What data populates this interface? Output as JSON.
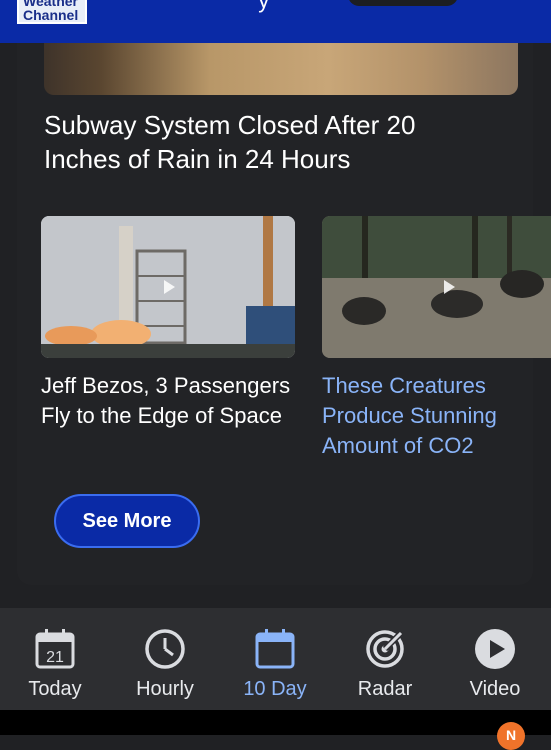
{
  "header": {
    "logo_line1": "Weather",
    "logo_line2": "Channel",
    "partial_text": "'y",
    "colors": {
      "bar": "#0a2aa6"
    }
  },
  "feature": {
    "title": "Subway System Closed After 20 Inches of Rain in 24 Hours"
  },
  "videos": [
    {
      "title": "Jeff Bezos, 3 Passengers Fly to the Edge of Space",
      "icon": "play-icon"
    },
    {
      "title": "These Creatures Produce Stunning Amount of CO2",
      "icon": "play-icon",
      "link_color": "#8ab4f8"
    }
  ],
  "see_more_label": "See More",
  "nav": {
    "active": "10 Day",
    "items": [
      {
        "label": "Today",
        "icon": "calendar-day-icon",
        "day": "21"
      },
      {
        "label": "Hourly",
        "icon": "clock-icon"
      },
      {
        "label": "10 Day",
        "icon": "calendar-icon"
      },
      {
        "label": "Radar",
        "icon": "radar-icon"
      },
      {
        "label": "Video",
        "icon": "play-circle-icon"
      }
    ]
  },
  "notification_badge": "N"
}
